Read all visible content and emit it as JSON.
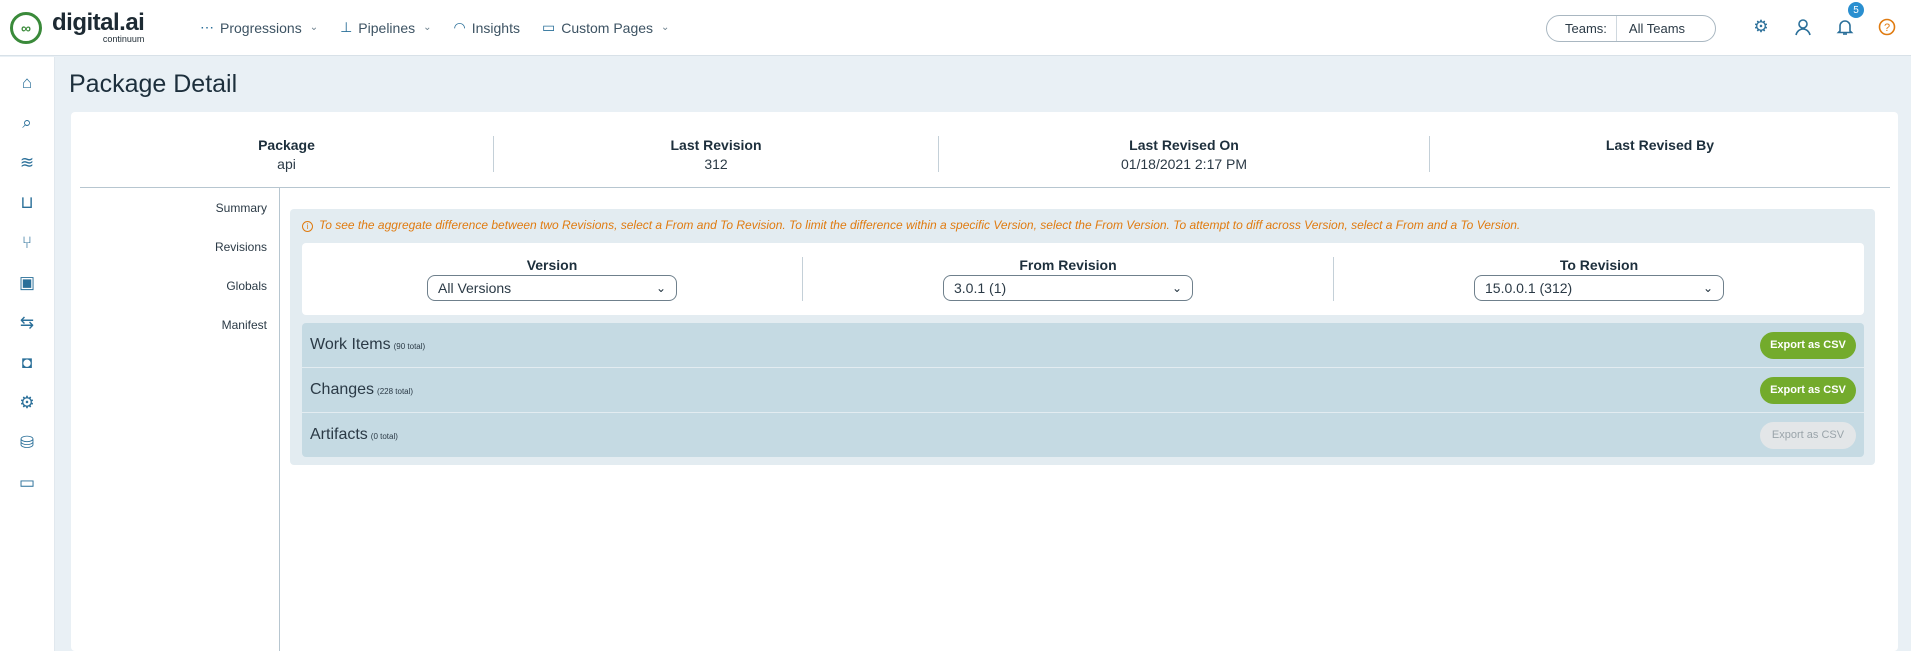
{
  "app": {
    "logo_main": "digital.ai",
    "logo_sub": "continuum"
  },
  "nav": {
    "items": [
      {
        "label": "Progressions",
        "icon": "progressions-icon",
        "has_dropdown": true
      },
      {
        "label": "Pipelines",
        "icon": "pipelines-icon",
        "has_dropdown": true
      },
      {
        "label": "Insights",
        "icon": "insights-icon",
        "has_dropdown": false
      },
      {
        "label": "Custom Pages",
        "icon": "custom-pages-icon",
        "has_dropdown": true
      }
    ]
  },
  "teams": {
    "label": "Teams:",
    "value": "All Teams"
  },
  "notifications": {
    "count": "5"
  },
  "page": {
    "title": "Package Detail"
  },
  "summary": {
    "package_label": "Package",
    "package_value": "api",
    "last_revision_label": "Last Revision",
    "last_revision_value": "312",
    "last_revised_on_label": "Last Revised On",
    "last_revised_on_value": "01/18/2021 2:17 PM",
    "last_revised_by_label": "Last Revised By",
    "last_revised_by_value": ""
  },
  "side_tabs": [
    "Summary",
    "Revisions",
    "Globals",
    "Manifest"
  ],
  "info_text": "To see the aggregate difference between two Revisions, select a From and To Revision. To limit the difference within a specific Version, select the From Version. To attempt to diff across Version, select a From and a To Version.",
  "filters": {
    "version_label": "Version",
    "version_value": "All Versions",
    "from_label": "From Revision",
    "from_value": "3.0.1 (1)",
    "to_label": "To Revision",
    "to_value": "15.0.0.1 (312)"
  },
  "sections": [
    {
      "title": "Work Items",
      "count": "(90 total)",
      "button": "Export as CSV",
      "enabled": true
    },
    {
      "title": "Changes",
      "count": "(228 total)",
      "button": "Export as CSV",
      "enabled": true
    },
    {
      "title": "Artifacts",
      "count": "(0 total)",
      "button": "Export as CSV",
      "enabled": false
    }
  ],
  "colors": {
    "accent": "#2a6f99",
    "export_green": "#73ab2c",
    "info_orange": "#e07b10",
    "section_bg": "#c5dae3"
  }
}
